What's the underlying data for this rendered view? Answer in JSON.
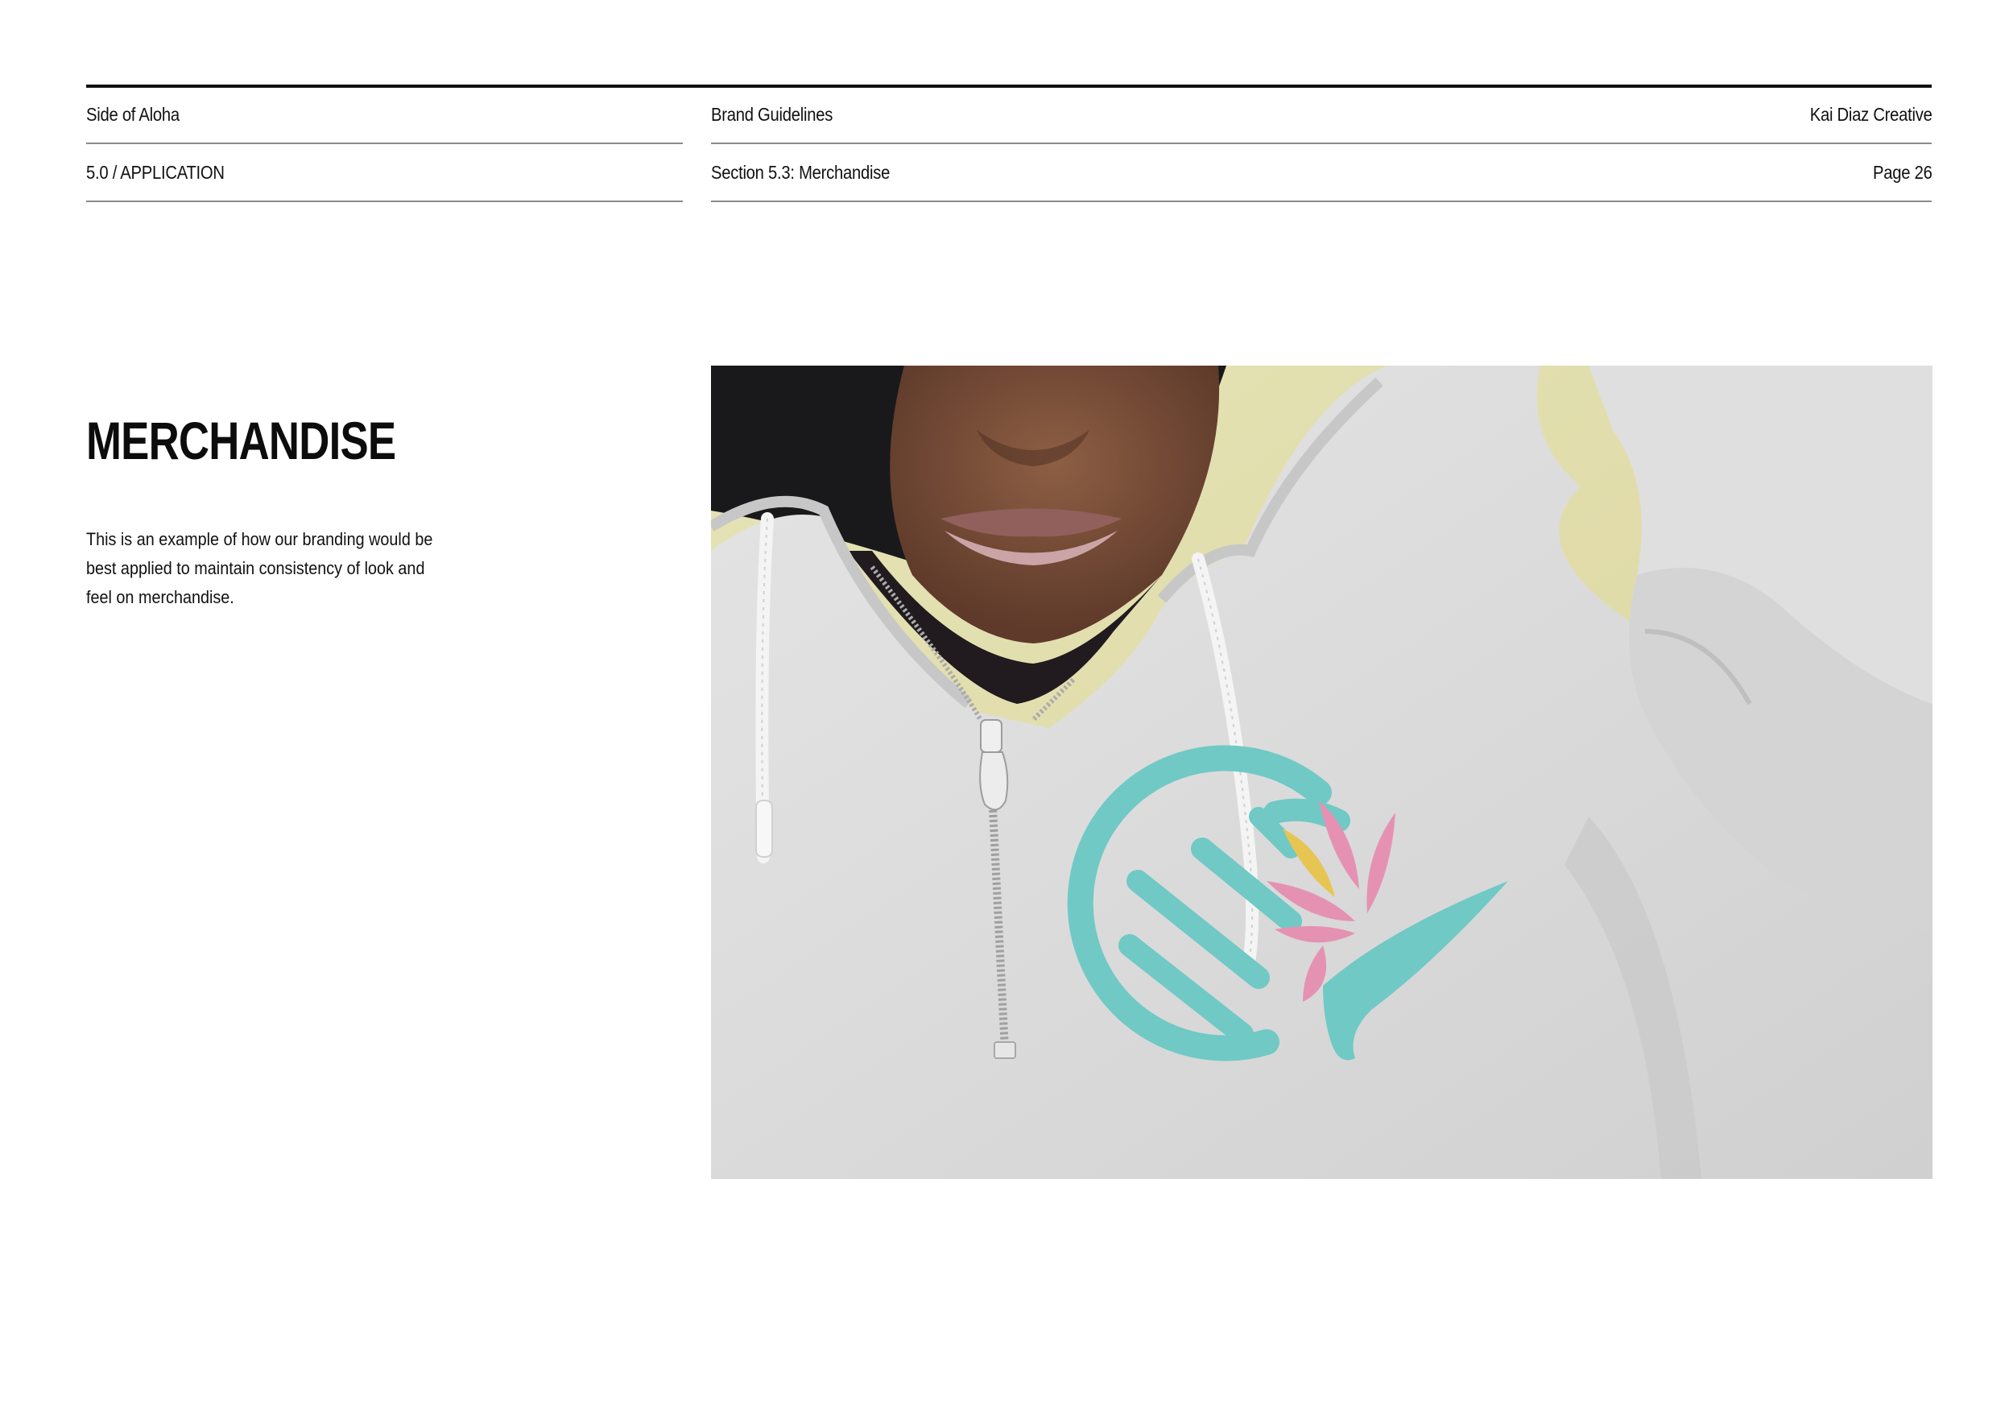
{
  "header": {
    "brand": "Side of Aloha",
    "document": "Brand Guidelines",
    "agency": "Kai Diaz Creative",
    "chapter": "5.0 / APPLICATION",
    "section": "Section 5.3: Merchandise",
    "page": "Page 26"
  },
  "main": {
    "title": "MERCHANDISE",
    "description": "This is an example of how our branding would be best applied to maintain consistency of look and feel on merchandise."
  },
  "photo": {
    "subject": "grey quarter-zip hoodie with brand logo",
    "logo_colors": {
      "teal": "#6cc8c4",
      "pink": "#e58fb0",
      "yellow": "#e6c44e"
    }
  }
}
